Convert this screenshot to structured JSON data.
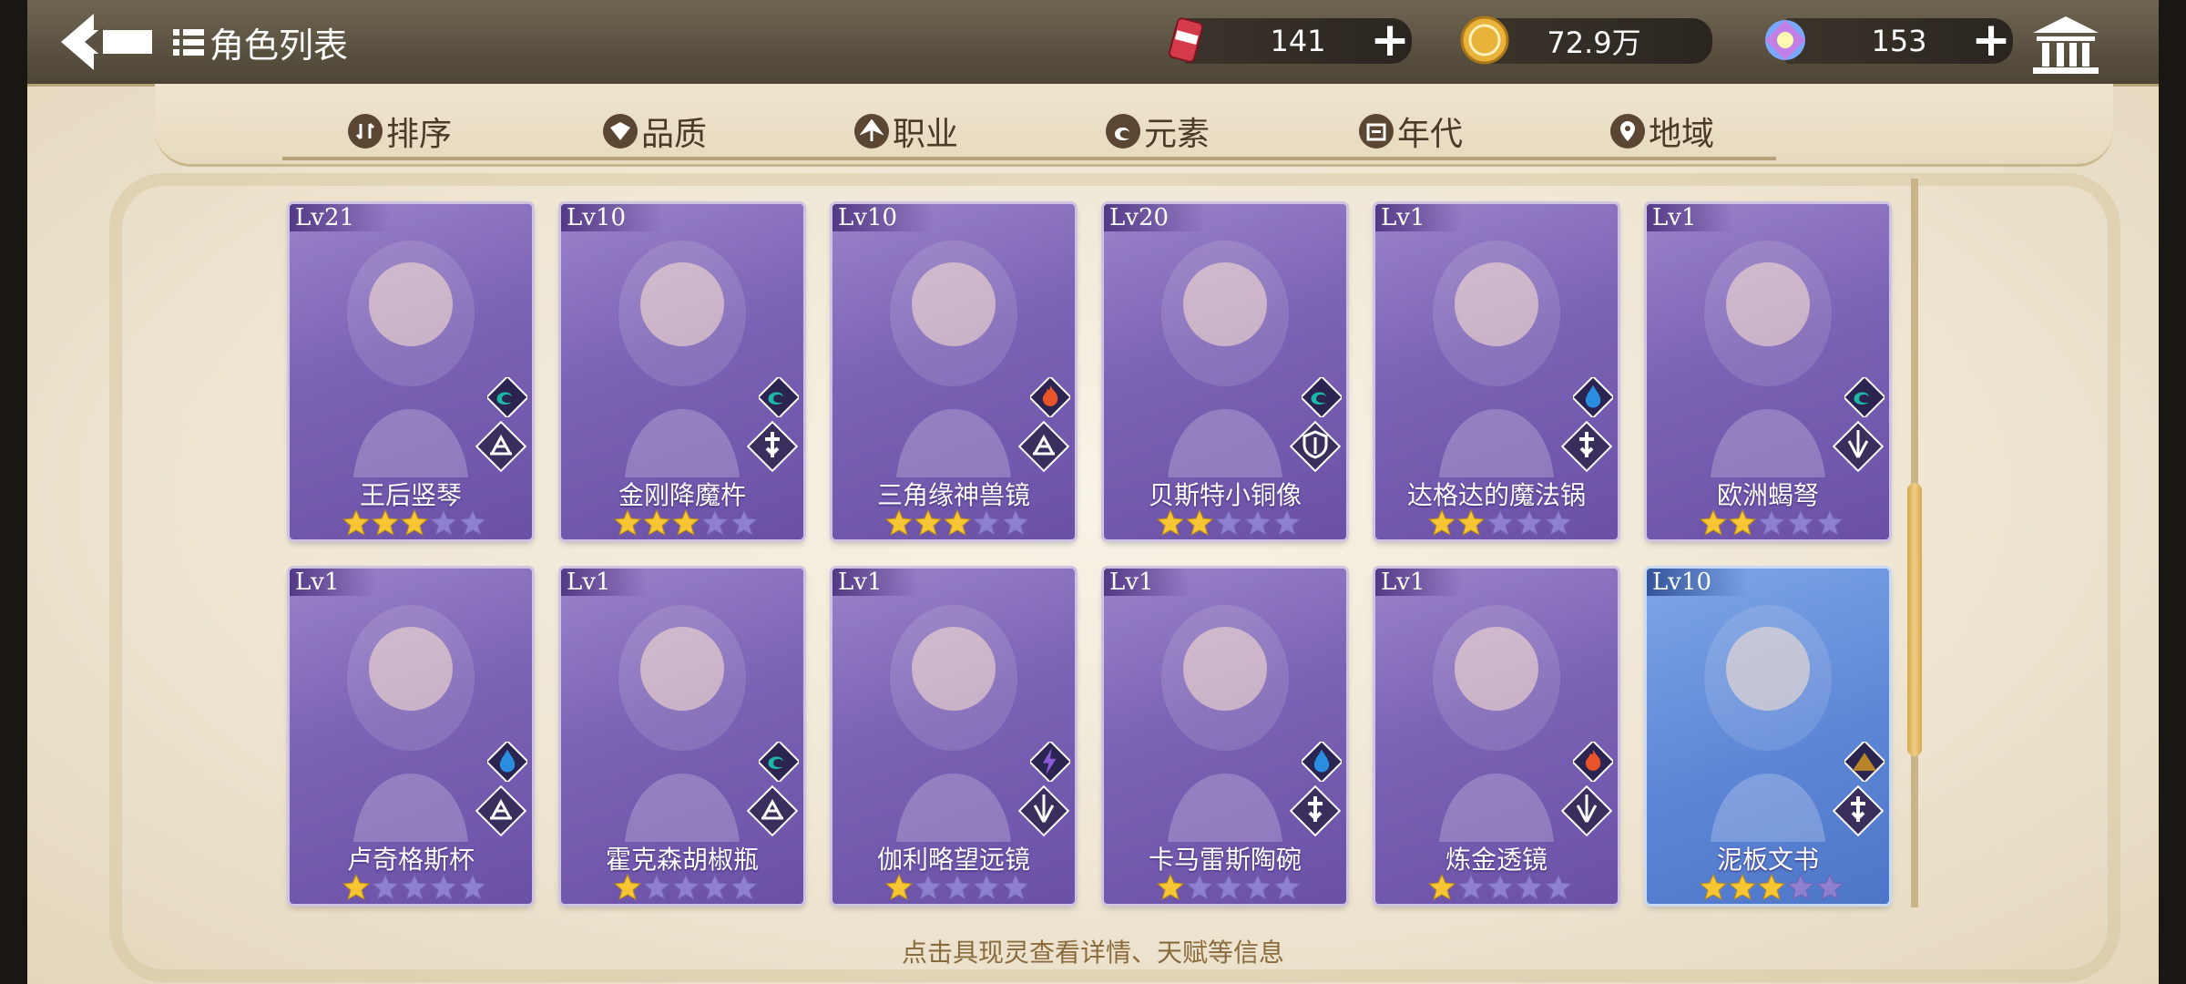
{
  "header": {
    "title": "角色列表",
    "resources": [
      {
        "id": "energy",
        "value": "141",
        "icon": "can-icon"
      },
      {
        "id": "coins",
        "value": "72.9万",
        "icon": "coin-icon"
      },
      {
        "id": "gems",
        "value": "153",
        "icon": "gem-icon"
      }
    ]
  },
  "tabs": [
    {
      "label": "排序",
      "icon": "sort-icon"
    },
    {
      "label": "品质",
      "icon": "quality-icon"
    },
    {
      "label": "职业",
      "icon": "class-icon"
    },
    {
      "label": "元素",
      "icon": "element-icon"
    },
    {
      "label": "年代",
      "icon": "era-icon"
    },
    {
      "label": "地域",
      "icon": "location-icon"
    }
  ],
  "characters": [
    {
      "level": "Lv21",
      "name": "王后竖琴",
      "stars": 3,
      "element": "wind",
      "class": "scholar",
      "rarity": "purple"
    },
    {
      "level": "Lv10",
      "name": "金刚降魔杵",
      "stars": 3,
      "element": "wind",
      "class": "healer",
      "rarity": "purple"
    },
    {
      "level": "Lv10",
      "name": "三角缘神兽镜",
      "stars": 3,
      "element": "fire",
      "class": "scholar",
      "rarity": "purple"
    },
    {
      "level": "Lv20",
      "name": "贝斯特小铜像",
      "stars": 2,
      "element": "wind",
      "class": "guardian",
      "rarity": "purple"
    },
    {
      "level": "Lv1",
      "name": "达格达的魔法锅",
      "stars": 2,
      "element": "water",
      "class": "healer",
      "rarity": "purple"
    },
    {
      "level": "Lv1",
      "name": "欧洲蝎弩",
      "stars": 2,
      "element": "wind",
      "class": "striker",
      "rarity": "purple"
    },
    {
      "level": "Lv1",
      "name": "卢奇格斯杯",
      "stars": 1,
      "element": "water",
      "class": "scholar",
      "rarity": "purple"
    },
    {
      "level": "Lv1",
      "name": "霍克森胡椒瓶",
      "stars": 1,
      "element": "wind",
      "class": "scholar",
      "rarity": "purple"
    },
    {
      "level": "Lv1",
      "name": "伽利略望远镜",
      "stars": 1,
      "element": "thunder",
      "class": "striker",
      "rarity": "purple"
    },
    {
      "level": "Lv1",
      "name": "卡马雷斯陶碗",
      "stars": 1,
      "element": "water",
      "class": "healer",
      "rarity": "purple"
    },
    {
      "level": "Lv1",
      "name": "炼金透镜",
      "stars": 1,
      "element": "fire",
      "class": "striker",
      "rarity": "purple"
    },
    {
      "level": "Lv10",
      "name": "泥板文书",
      "stars": 3,
      "element": "earth",
      "class": "healer",
      "rarity": "blue"
    }
  ],
  "hint": "点击具现灵查看详情、天赋等信息",
  "colors": {
    "topbar": "#5a5142",
    "card_purple": "#7a62b4",
    "card_blue": "#5d86d6",
    "star_on": "#f6c634",
    "star_off": "#8f80cf",
    "wind": "#1bb8a8",
    "fire": "#e8532a",
    "water": "#2a8de0",
    "thunder": "#8a5ad8",
    "earth": "#b8842a"
  }
}
